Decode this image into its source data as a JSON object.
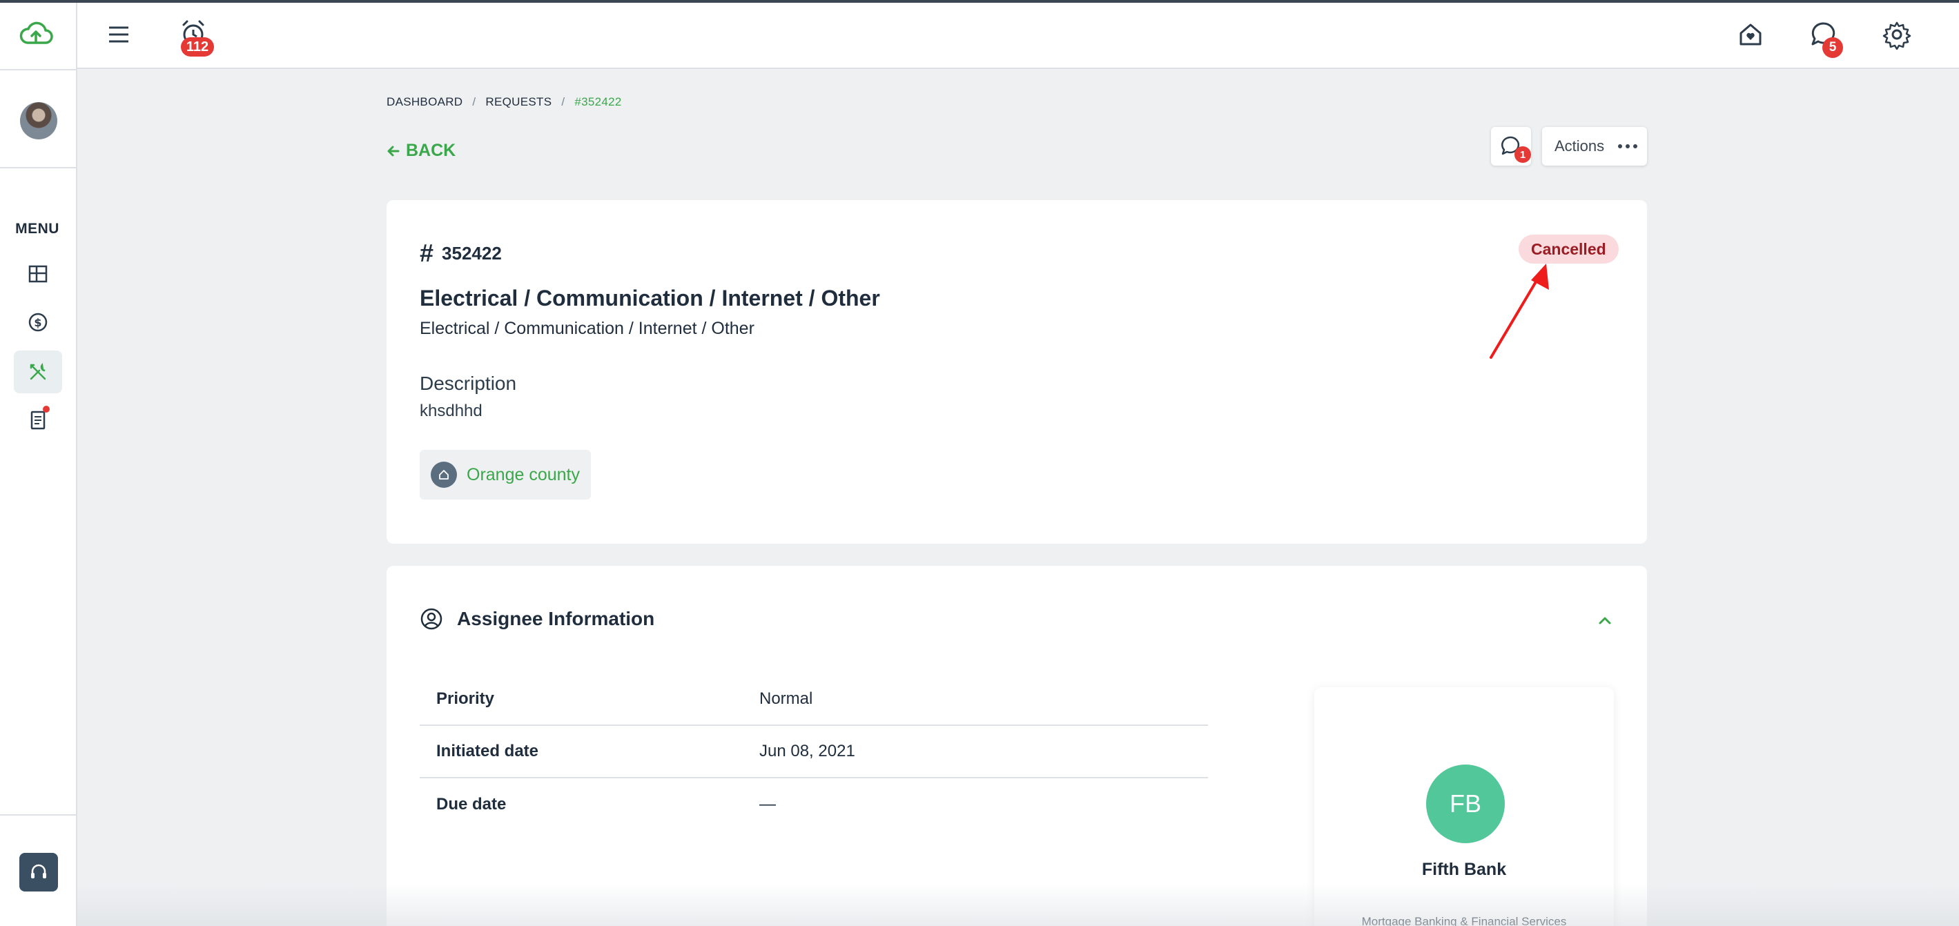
{
  "sidebar": {
    "menu_label": "MENU",
    "items": [
      {
        "name": "dashboard"
      },
      {
        "name": "payments"
      },
      {
        "name": "maintenance",
        "active": true
      },
      {
        "name": "documents",
        "has_notification": true
      }
    ]
  },
  "topbar": {
    "alarm_count": "112",
    "chat_count": "5"
  },
  "breadcrumb": {
    "items": [
      "DASHBOARD",
      "REQUESTS",
      "#352422"
    ],
    "separator": "/"
  },
  "back_label": "BACK",
  "toolbar": {
    "bell_count": "1",
    "actions_label": "Actions"
  },
  "request": {
    "id": "352422",
    "status": "Cancelled",
    "title": "Electrical / Communication / Internet / Other",
    "subtitle": "Electrical / Communication / Internet / Other",
    "description_label": "Description",
    "description": "khsdhhd",
    "property": "Orange county"
  },
  "assignee_section": {
    "title": "Assignee Information",
    "rows": [
      {
        "label": "Priority",
        "value": "Normal"
      },
      {
        "label": "Initiated date",
        "value": "Jun 08, 2021"
      },
      {
        "label": "Due date",
        "value": "—"
      }
    ],
    "assignee": {
      "initials": "FB",
      "name": "Fifth Bank",
      "category": "Mortgage Banking & Financial Services"
    }
  },
  "colors": {
    "accent": "#3aa84a",
    "badge_red": "#e53935",
    "status_bg": "#fadadd",
    "status_text": "#9b1c23",
    "avatar_green": "#52c79a"
  }
}
